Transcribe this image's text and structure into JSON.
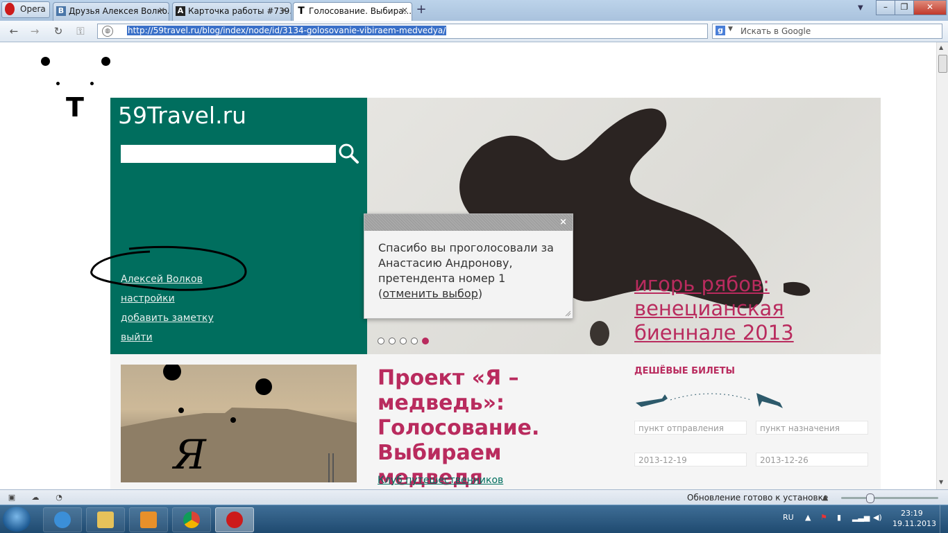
{
  "browser": {
    "opera_label": "Opera",
    "tabs": [
      {
        "favicon": "B",
        "title": "Друзья Алексея Волко..."
      },
      {
        "favicon": "A",
        "title": "Карточка работы #739..."
      },
      {
        "favicon": "T",
        "title": "Голосование. Выбира..."
      }
    ],
    "url": "http://59travel.ru/blog/index/node/id/3134-golosovanie-vibiraem-medvedya/",
    "search_engine_letter": "g",
    "search_placeholder": "Искать в Google"
  },
  "page": {
    "corner_letter": "T",
    "site_logo": "59Travel.ru",
    "user_links": {
      "profile": "Алексей Волков",
      "settings": "настройки",
      "add_note": "добавить заметку",
      "logout": "выйти"
    },
    "hero": {
      "title_line1": "игорь рябов:",
      "title_line2": "венецианская",
      "title_line3": "биеннале 2013",
      "active_dot": 5
    },
    "popup": {
      "close_glyph": "×",
      "message": "Спасибо вы проголосовали за Анастасию Андронову, претендента номер 1",
      "open_paren": "(",
      "cancel_link": "отменить выбор",
      "close_paren": ")"
    },
    "article": {
      "title": "Проект «Я – медведь»: Голосование. Выбираем медведя",
      "club_link": "Клуб путешественников",
      "photo_glyph": "Я"
    },
    "tickets": {
      "heading": "ДЕШЁВЫЕ БИЛЕТЫ",
      "from_placeholder": "пункт отправления",
      "to_placeholder": "пункт назначения",
      "date_from": "2013-12-19",
      "date_to": "2013-12-26"
    }
  },
  "statusbar": {
    "update_text": "Обновление готово к установке"
  },
  "taskbar": {
    "language": "RU",
    "time": "23:19",
    "date": "19.11.2013"
  },
  "colors": {
    "brand_green": "#006e5e",
    "accent_magenta": "#b92b5e"
  }
}
